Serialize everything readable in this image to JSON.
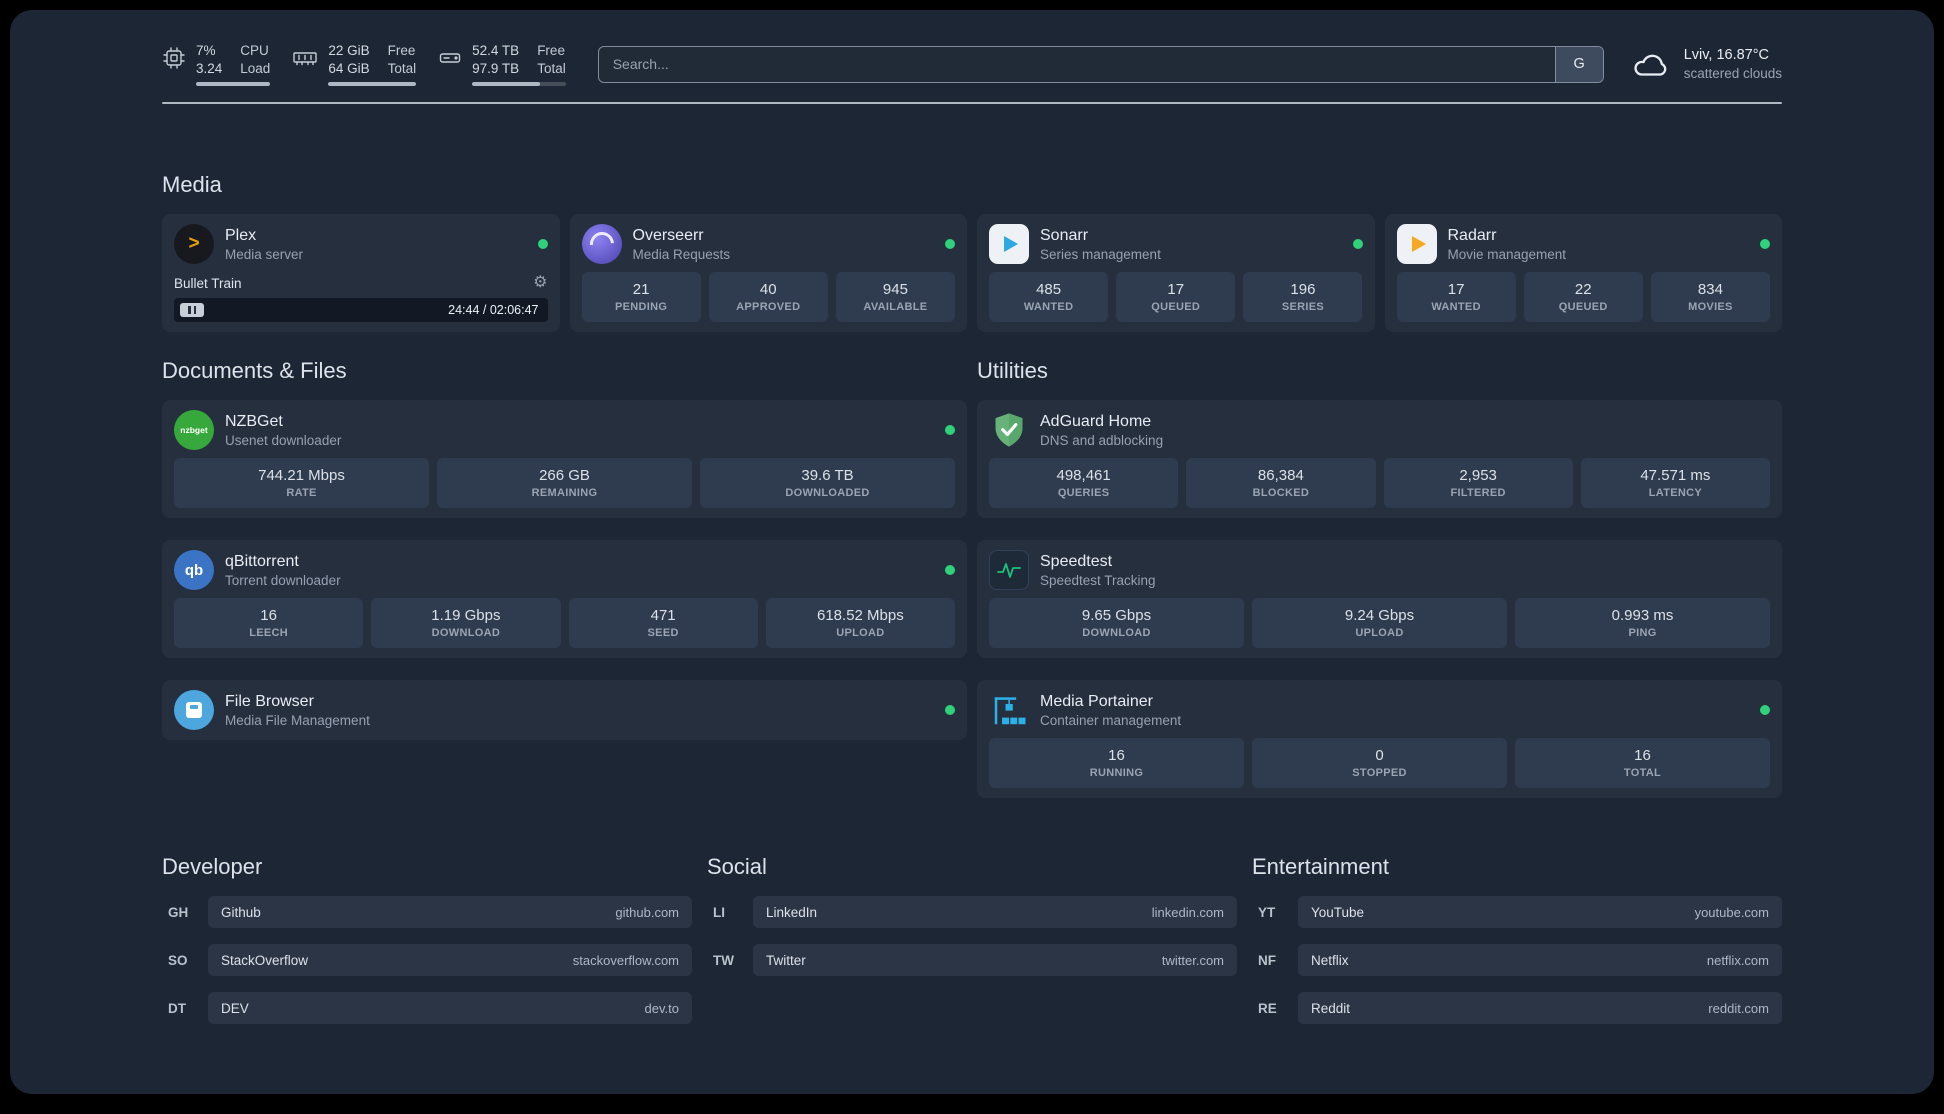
{
  "topbar": {
    "cpu": {
      "value_top": "7%",
      "value_bottom": "3.24",
      "label_top": "CPU",
      "label_bottom": "Load"
    },
    "memory": {
      "value_top": "22 GiB",
      "value_bottom": "64 GiB",
      "label_top": "Free",
      "label_bottom": "Total"
    },
    "disk": {
      "value_top": "52.4 TB",
      "value_bottom": "97.9 TB",
      "label_top": "Free",
      "label_bottom": "Total"
    },
    "search": {
      "placeholder": "Search...",
      "button_label": "G"
    },
    "weather": {
      "location": "Lviv, 16.87°C",
      "condition": "scattered clouds"
    }
  },
  "media": {
    "title": "Media",
    "plex": {
      "name": "Plex",
      "description": "Media server",
      "icon_glyph": ">",
      "player": {
        "track": "Bullet Train",
        "time": "24:44 / 02:06:47"
      }
    },
    "overseerr": {
      "name": "Overseerr",
      "description": "Media Requests",
      "stats": [
        {
          "value": "21",
          "label": "PENDING"
        },
        {
          "value": "40",
          "label": "APPROVED"
        },
        {
          "value": "945",
          "label": "AVAILABLE"
        }
      ]
    },
    "sonarr": {
      "name": "Sonarr",
      "description": "Series management",
      "stats": [
        {
          "value": "485",
          "label": "WANTED"
        },
        {
          "value": "17",
          "label": "QUEUED"
        },
        {
          "value": "196",
          "label": "SERIES"
        }
      ]
    },
    "radarr": {
      "name": "Radarr",
      "description": "Movie management",
      "stats": [
        {
          "value": "17",
          "label": "WANTED"
        },
        {
          "value": "22",
          "label": "QUEUED"
        },
        {
          "value": "834",
          "label": "MOVIES"
        }
      ]
    }
  },
  "documents": {
    "title": "Documents & Files",
    "nzbget": {
      "name": "NZBGet",
      "description": "Usenet downloader",
      "icon_text": "nzbget",
      "stats": [
        {
          "value": "744.21 Mbps",
          "label": "RATE"
        },
        {
          "value": "266 GB",
          "label": "REMAINING"
        },
        {
          "value": "39.6 TB",
          "label": "DOWNLOADED"
        }
      ]
    },
    "qbittorrent": {
      "name": "qBittorrent",
      "description": "Torrent downloader",
      "icon_text": "qb",
      "stats": [
        {
          "value": "16",
          "label": "LEECH"
        },
        {
          "value": "1.19 Gbps",
          "label": "DOWNLOAD"
        },
        {
          "value": "471",
          "label": "SEED"
        },
        {
          "value": "618.52 Mbps",
          "label": "UPLOAD"
        }
      ]
    },
    "filebrowser": {
      "name": "File Browser",
      "description": "Media File Management"
    }
  },
  "utilities": {
    "title": "Utilities",
    "adguard": {
      "name": "AdGuard Home",
      "description": "DNS and adblocking",
      "stats": [
        {
          "value": "498,461",
          "label": "QUERIES"
        },
        {
          "value": "86,384",
          "label": "BLOCKED"
        },
        {
          "value": "2,953",
          "label": "FILTERED"
        },
        {
          "value": "47.571 ms",
          "label": "LATENCY"
        }
      ]
    },
    "speedtest": {
      "name": "Speedtest",
      "description": "Speedtest Tracking",
      "stats": [
        {
          "value": "9.65 Gbps",
          "label": "DOWNLOAD"
        },
        {
          "value": "9.24 Gbps",
          "label": "UPLOAD"
        },
        {
          "value": "0.993 ms",
          "label": "PING"
        }
      ]
    },
    "portainer": {
      "name": "Media Portainer",
      "description": "Container management",
      "stats": [
        {
          "value": "16",
          "label": "RUNNING"
        },
        {
          "value": "0",
          "label": "STOPPED"
        },
        {
          "value": "16",
          "label": "TOTAL"
        }
      ]
    }
  },
  "bookmarks": {
    "developer": {
      "title": "Developer",
      "items": [
        {
          "abbr": "GH",
          "name": "Github",
          "url": "github.com"
        },
        {
          "abbr": "SO",
          "name": "StackOverflow",
          "url": "stackoverflow.com"
        },
        {
          "abbr": "DT",
          "name": "DEV",
          "url": "dev.to"
        }
      ]
    },
    "social": {
      "title": "Social",
      "items": [
        {
          "abbr": "LI",
          "name": "LinkedIn",
          "url": "linkedin.com"
        },
        {
          "abbr": "TW",
          "name": "Twitter",
          "url": "twitter.com"
        }
      ]
    },
    "entertainment": {
      "title": "Entertainment",
      "items": [
        {
          "abbr": "YT",
          "name": "YouTube",
          "url": "youtube.com"
        },
        {
          "abbr": "NF",
          "name": "Netflix",
          "url": "netflix.com"
        },
        {
          "abbr": "RE",
          "name": "Reddit",
          "url": "reddit.com"
        }
      ]
    }
  }
}
